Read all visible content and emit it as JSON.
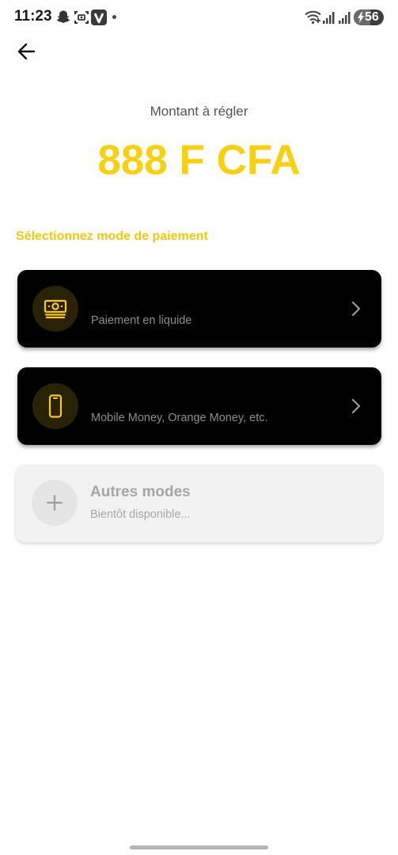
{
  "status_bar": {
    "time": "11:23",
    "battery_level": "56",
    "battery_fraction": 0.56,
    "left_icons": [
      "snapchat-icon",
      "screenshot-icon",
      "v-app-icon"
    ],
    "right_icons": [
      "wifi-icon",
      "signal-icon",
      "signal-icon-2",
      "battery-icon"
    ]
  },
  "header": {
    "back_icon": "arrow-left-icon"
  },
  "amount": {
    "label": "Montant à régler",
    "value": "888 F CFA",
    "color": "#f7d011"
  },
  "section": {
    "title": "Sélectionnez mode de paiement",
    "color": "#f2c80f"
  },
  "payment_methods": [
    {
      "icon": "cash-icon",
      "title": "",
      "subtitle": "Paiement en liquide",
      "chevron": "chevron-right-icon"
    },
    {
      "icon": "mobile-phone-icon",
      "title": "",
      "subtitle": "Mobile Money, Orange Money, etc.",
      "chevron": "chevron-right-icon"
    }
  ],
  "other_modes": {
    "icon": "plus-icon",
    "title": "Autres modes",
    "subtitle": "Bientôt disponible..."
  }
}
